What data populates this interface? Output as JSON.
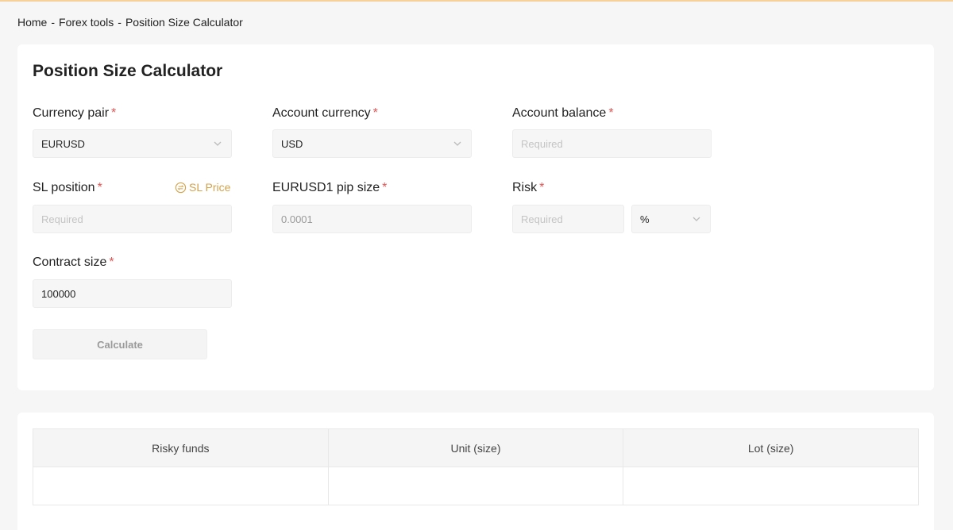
{
  "breadcrumb": {
    "home": "Home",
    "sep1": "-",
    "forex_tools": "Forex tools",
    "sep2": "-",
    "current": "Position Size Calculator"
  },
  "calculator": {
    "title": "Position Size Calculator",
    "required_mark": "*",
    "currency_pair": {
      "label": "Currency pair",
      "value": "EURUSD"
    },
    "account_currency": {
      "label": "Account currency",
      "value": "USD"
    },
    "account_balance": {
      "label": "Account balance",
      "placeholder": "Required",
      "value": ""
    },
    "sl_position": {
      "label": "SL position",
      "placeholder": "Required",
      "value": ""
    },
    "sl_toggle": {
      "label": "SL Price"
    },
    "pip_size": {
      "label": "EURUSD1 pip size",
      "value": "0.0001"
    },
    "risk": {
      "label": "Risk",
      "placeholder": "Required",
      "value": "",
      "unit": "%"
    },
    "contract_size": {
      "label": "Contract size",
      "value": "100000"
    },
    "calculate_label": "Calculate"
  },
  "results": {
    "columns": [
      "Risky funds",
      "Unit (size)",
      "Lot (size)"
    ],
    "row": [
      "",
      "",
      ""
    ]
  },
  "colors": {
    "accent": "#d4a24c",
    "required": "#e05555",
    "top_line": "#f6d19a"
  }
}
